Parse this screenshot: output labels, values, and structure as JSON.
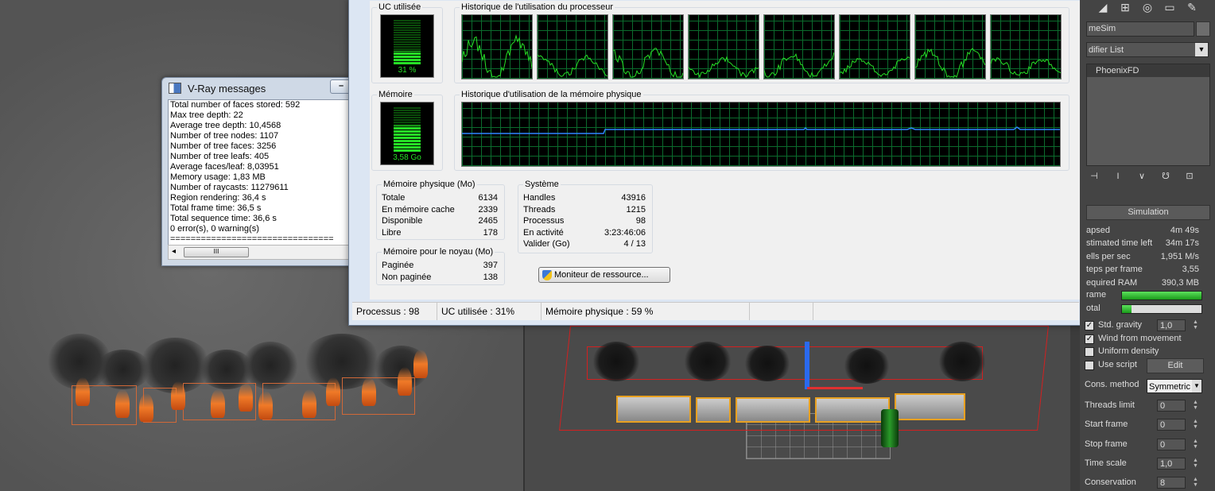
{
  "vray": {
    "title": "V-Ray messages",
    "lines": [
      "Total number of faces stored: 592",
      "Max tree depth: 22",
      "Average tree depth: 10,4568",
      "Number of tree nodes: 1107",
      "Number of tree faces: 3256",
      "Number of tree leafs: 405",
      "Average faces/leaf: 8,03951",
      "Memory usage: 1,83 MB",
      "Number of raycasts: 11279611",
      "Region rendering: 36,4 s",
      "Total frame time: 36,5 s",
      "Total sequence time: 36,6 s",
      "0 error(s), 0 warning(s)",
      "================================"
    ],
    "scroll_arrow": "◂",
    "scroll_thumb": "III"
  },
  "taskmgr": {
    "cpu_label": "UC utilisée",
    "cpu_value": "31 %",
    "cpu_fraction": 0.31,
    "cpu_history_label": "Historique de l'utilisation du processeur",
    "mem_label": "Mémoire",
    "mem_value": "3,58 Go",
    "mem_fraction": 0.59,
    "mem_history_label": "Historique d'utilisation de la mémoire physique",
    "phys": {
      "label": "Mémoire physique (Mo)",
      "rows": [
        {
          "k": "Totale",
          "v": "6134"
        },
        {
          "k": "En mémoire cache",
          "v": "2339"
        },
        {
          "k": "Disponible",
          "v": "2465"
        },
        {
          "k": "Libre",
          "v": "178"
        }
      ]
    },
    "kernel": {
      "label": "Mémoire pour le noyau (Mo)",
      "rows": [
        {
          "k": "Paginée",
          "v": "397"
        },
        {
          "k": "Non paginée",
          "v": "138"
        }
      ]
    },
    "system": {
      "label": "Système",
      "rows": [
        {
          "k": "Handles",
          "v": "43916"
        },
        {
          "k": "Threads",
          "v": "1215"
        },
        {
          "k": "Processus",
          "v": "98"
        },
        {
          "k": "En activité",
          "v": "3:23:46:06"
        },
        {
          "k": "Valider (Go)",
          "v": "4 / 13"
        }
      ]
    },
    "resource_button": "Moniteur de ressource...",
    "status": {
      "processes": "Processus : 98",
      "cpu": "UC utilisée : 31%",
      "memory": "Mémoire physique : 59 %"
    },
    "colors": {
      "graph_line": "#26e026",
      "mem_line": "#2f86ff",
      "grid": "#0b6b2d"
    }
  },
  "max": {
    "tab_icons": [
      "create-icon",
      "hierarchy-icon",
      "motion-icon",
      "display-icon",
      "utilities-icon"
    ],
    "object_name": "meSim",
    "modifier_list": "difier List",
    "stack_item": "PhoenixFD",
    "rollout_title": "Simulation",
    "stats": [
      {
        "k": "apsed",
        "v": "4m 49s"
      },
      {
        "k": "stimated time left",
        "v": "34m 17s"
      },
      {
        "k": "ells per sec",
        "v": "1,951 M/s"
      },
      {
        "k": "teps per frame",
        "v": "3,55"
      },
      {
        "k": "equired RAM",
        "v": "390,3 MB"
      }
    ],
    "progress": [
      {
        "k": "rame",
        "fraction": 1.0
      },
      {
        "k": "otal",
        "fraction": 0.12
      }
    ],
    "checks": [
      {
        "label": "Std. gravity",
        "checked": true,
        "value": "1,0"
      },
      {
        "label": "Wind from movement",
        "checked": true
      },
      {
        "label": "Uniform density",
        "checked": false
      },
      {
        "label": "Use script",
        "checked": false,
        "button": "Edit"
      }
    ],
    "cons_method_label": "Cons. method",
    "cons_method_value": "Symmetric",
    "params": [
      {
        "k": "Threads limit",
        "v": "0"
      },
      {
        "k": "Start frame",
        "v": "0"
      },
      {
        "k": "Stop frame",
        "v": "0"
      },
      {
        "k": "Time scale",
        "v": "1,0"
      },
      {
        "k": "Conservation",
        "v": "8"
      }
    ]
  }
}
